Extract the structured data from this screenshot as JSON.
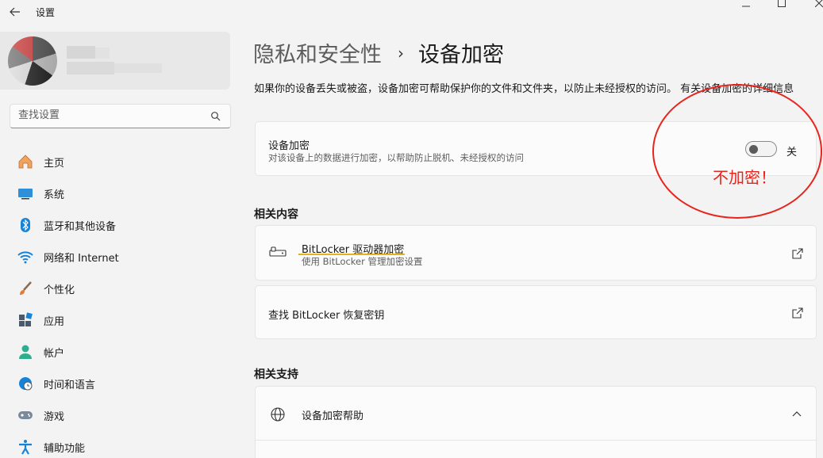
{
  "titlebar": {
    "title": "设置"
  },
  "search": {
    "placeholder": "查找设置"
  },
  "nav": [
    {
      "label": "主页",
      "icon": "home-icon"
    },
    {
      "label": "系统",
      "icon": "monitor-icon"
    },
    {
      "label": "蓝牙和其他设备",
      "icon": "bluetooth-icon"
    },
    {
      "label": "网络和 Internet",
      "icon": "wifi-icon"
    },
    {
      "label": "个性化",
      "icon": "brush-icon"
    },
    {
      "label": "应用",
      "icon": "apps-icon"
    },
    {
      "label": "帐户",
      "icon": "account-icon"
    },
    {
      "label": "时间和语言",
      "icon": "globe-clock-icon"
    },
    {
      "label": "游戏",
      "icon": "gamepad-icon"
    },
    {
      "label": "辅助功能",
      "icon": "accessibility-icon"
    }
  ],
  "breadcrumb": {
    "parent": "隐私和安全性",
    "separator": "›",
    "current": "设备加密"
  },
  "intro": {
    "text": "如果你的设备丢失或被盗，设备加密可帮助保护你的文件和文件夹，以防止未经授权的访问。",
    "link": "有关设备加密的详细信息"
  },
  "encryption": {
    "title": "设备加密",
    "description": "对该设备上的数据进行加密，以帮助防止脱机、未经授权的访问",
    "state_label": "关"
  },
  "related_content": {
    "title": "相关内容",
    "bitlocker": {
      "title": "BitLocker 驱动器加密",
      "description": "使用 BitLocker 管理加密设置"
    },
    "recovery": {
      "title": "查找 BitLocker 恢复密钥"
    }
  },
  "related_support": {
    "title": "相关支持",
    "help": {
      "title": "设备加密帮助"
    }
  },
  "annotation": {
    "text": "不加密！"
  },
  "colors": {
    "accent": "#0067c0",
    "annotation": "#e8241c",
    "highlight": "#e4b21b"
  }
}
